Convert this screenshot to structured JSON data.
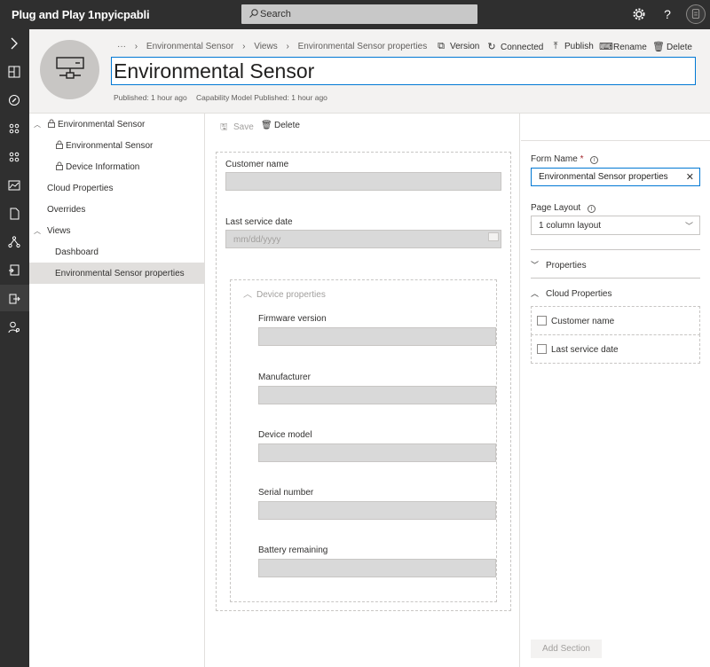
{
  "app": {
    "title": "Plug and Play 1npyicpabli"
  },
  "search": {
    "placeholder": "Search"
  },
  "header": {
    "breadcrumb": [
      "···",
      "Environmental Sensor",
      "Views",
      "Environmental Sensor properties"
    ],
    "actions": {
      "version": "Version",
      "connected": "Connected",
      "publish": "Publish",
      "rename": "Rename",
      "delete": "Delete"
    },
    "title": "Environmental Sensor",
    "published": "Published: 1 hour ago",
    "capability_published": "Capability Model Published: 1 hour ago"
  },
  "tree": {
    "items": [
      {
        "label": "Environmental Sensor"
      },
      {
        "label": "Environmental Sensor"
      },
      {
        "label": "Device Information"
      },
      {
        "label": "Cloud Properties"
      },
      {
        "label": "Overrides"
      },
      {
        "label": "Views"
      },
      {
        "label": "Dashboard"
      },
      {
        "label": "Environmental Sensor properties"
      }
    ]
  },
  "main": {
    "toolbar": {
      "save": "Save",
      "delete": "Delete"
    },
    "fields": {
      "customer_name": "Customer name",
      "last_service_date": "Last service date",
      "date_placeholder": "mm/dd/yyyy"
    },
    "section": {
      "title": "Device properties",
      "fields": [
        "Firmware version",
        "Manufacturer",
        "Device model",
        "Serial number",
        "Battery remaining"
      ]
    }
  },
  "panel": {
    "form_name_label": "Form Name",
    "form_name_required": "*",
    "form_name_value": "Environmental Sensor properties",
    "page_layout_label": "Page Layout",
    "page_layout_value": "1 column layout",
    "properties_label": "Properties",
    "cloud_properties_label": "Cloud Properties",
    "cloud_properties": [
      "Customer name",
      "Last service date"
    ],
    "add_section": "Add Section"
  },
  "colors": {
    "accent": "#0078d4",
    "topbar": "#2f2f2f",
    "selected": "#e1dfdd"
  }
}
